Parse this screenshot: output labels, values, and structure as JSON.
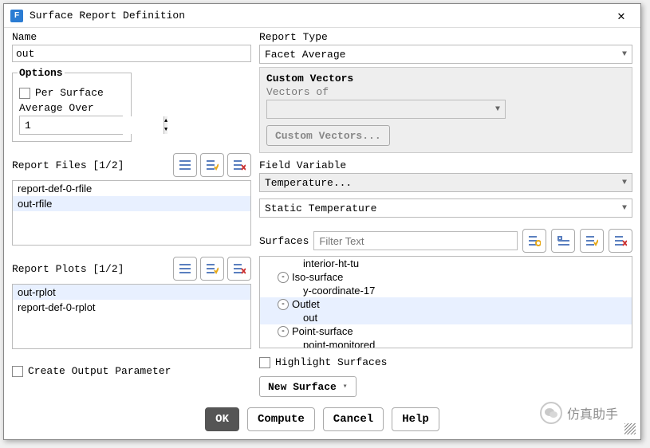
{
  "title": "Surface Report Definition",
  "left": {
    "name_label": "Name",
    "name_value": "out",
    "options_label": "Options",
    "per_surface_label": "Per Surface",
    "average_over_label": "Average Over",
    "average_over_value": "1",
    "report_files_label": "Report Files [1/2]",
    "report_files": [
      "report-def-0-rfile",
      "out-rfile"
    ],
    "report_files_selected": 1,
    "report_plots_label": "Report Plots [1/2]",
    "report_plots": [
      "out-rplot",
      "report-def-0-rplot"
    ],
    "report_plots_selected": 0,
    "create_output_label": "Create Output Parameter"
  },
  "right": {
    "report_type_label": "Report Type",
    "report_type_value": "Facet Average",
    "custom_vectors_title": "Custom Vectors",
    "vectors_of_label": "Vectors of",
    "vectors_of_value": "",
    "custom_vectors_btn": "Custom Vectors...",
    "field_variable_label": "Field Variable",
    "field_variable_top": "Temperature...",
    "field_variable_sub": "Static Temperature",
    "surfaces_label": "Surfaces",
    "surfaces_filter_placeholder": "Filter Text",
    "surfaces_tree": [
      {
        "text": "interior-ht-tu",
        "indent": 3,
        "toggle": null,
        "selected": false
      },
      {
        "text": "Iso-surface",
        "indent": 1,
        "toggle": "-",
        "selected": false
      },
      {
        "text": "y-coordinate-17",
        "indent": 3,
        "toggle": null,
        "selected": false
      },
      {
        "text": "Outlet",
        "indent": 1,
        "toggle": "-",
        "selected": true
      },
      {
        "text": "out",
        "indent": 3,
        "toggle": null,
        "selected": true
      },
      {
        "text": "Point-surface",
        "indent": 1,
        "toggle": "-",
        "selected": false
      },
      {
        "text": "point-monitored",
        "indent": 3,
        "toggle": null,
        "selected": false
      }
    ],
    "highlight_surfaces_label": "Highlight Surfaces",
    "new_surface_btn": "New Surface"
  },
  "buttons": {
    "ok": "OK",
    "compute": "Compute",
    "cancel": "Cancel",
    "help": "Help"
  },
  "watermark": "仿真助手"
}
